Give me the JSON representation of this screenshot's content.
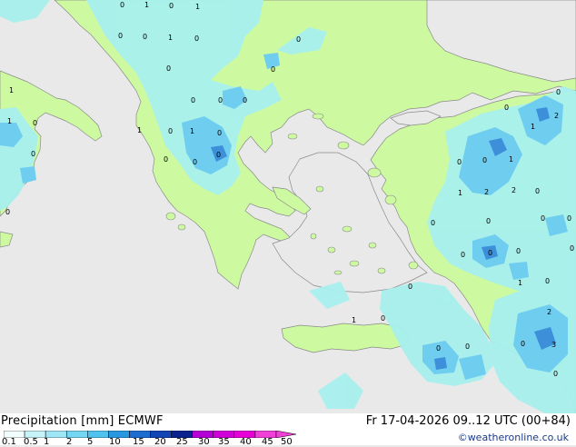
{
  "title": "Precipitation [mm] ECMWF",
  "run_info": "Fr 17-04-2026 09..12 UTC (00+84)",
  "credit": "©weatheronline.co.uk",
  "colors": {
    "sea": "#e9e9e9",
    "land_dry": "#cdfaa0",
    "light_precip": "#a8f0ee",
    "mid_precip": "#6fcdf0",
    "heavy_precip": "#3c8fd8",
    "coast": "#8a8a8a"
  },
  "legend": {
    "labels": [
      "0.1",
      "0.5",
      "1",
      "2",
      "5",
      "10",
      "15",
      "20",
      "25",
      "30",
      "35",
      "40",
      "45",
      "50"
    ],
    "colors": [
      "#f2fefe",
      "#c6f3f8",
      "#9ee6f5",
      "#74d6f2",
      "#4fc2ee",
      "#2a98e0",
      "#1c6cd0",
      "#1244b6",
      "#0a228e",
      "#b400d6",
      "#d000d8",
      "#e800d8",
      "#f040d8"
    ]
  },
  "values": [
    "0",
    "1",
    "0",
    "1",
    "0",
    "0",
    "1",
    "0",
    "0",
    "0",
    "1",
    "0",
    "1",
    "0",
    "0",
    "1",
    "0",
    "0",
    "0",
    "0",
    "0",
    "1",
    "0",
    "0",
    "0",
    "0",
    "0",
    "0",
    "1",
    "2",
    "1",
    "0",
    "0",
    "2",
    "0",
    "1",
    "2",
    "0",
    "0",
    "0",
    "0",
    "0",
    "0",
    "0",
    "0",
    "0",
    "1",
    "0",
    "1",
    "0",
    "0",
    "3",
    "0",
    "2",
    "0",
    "0"
  ]
}
